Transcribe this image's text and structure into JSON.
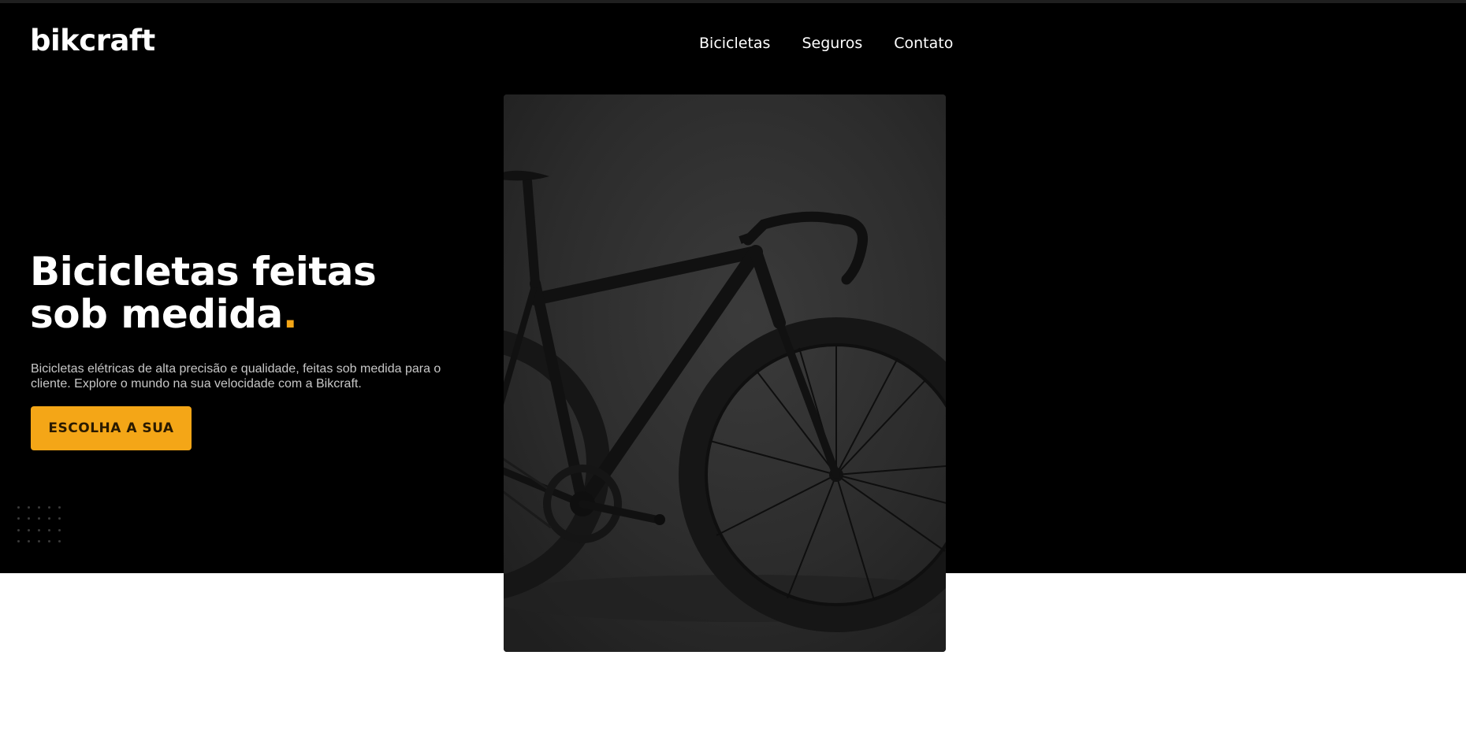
{
  "brand": {
    "logo_text": "bikcraft"
  },
  "nav": {
    "items": [
      {
        "label": "Bicicletas"
      },
      {
        "label": "Seguros"
      },
      {
        "label": "Contato"
      }
    ]
  },
  "hero": {
    "title": "Bicicletas feitas sob medida",
    "title_dot": ".",
    "description": "Bicicletas elétricas de alta precisão e qualidade, feitas sob medida para o cliente. Explore o mundo na sua velocidade com a Bikcraft.",
    "cta_label": "ESCOLHA A SUA",
    "image_icon": "bicycle-photo"
  },
  "colors": {
    "accent": "#f4a617",
    "hero_background": "#000000",
    "page_background": "#ffffff"
  }
}
